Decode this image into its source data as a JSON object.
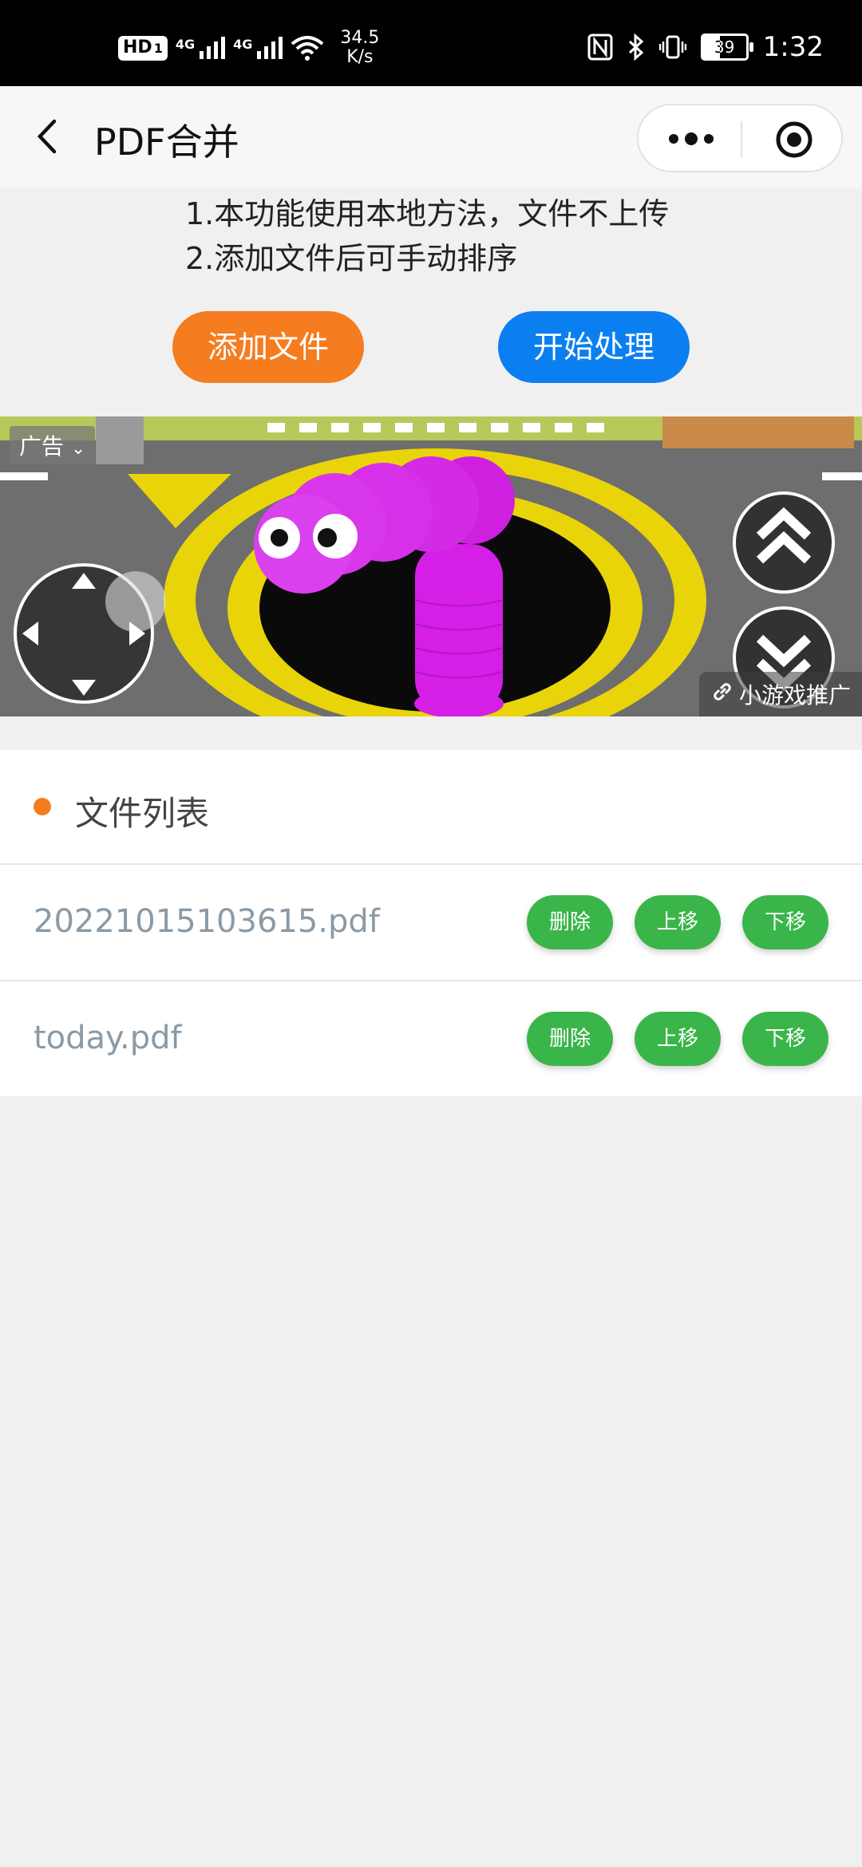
{
  "status_bar": {
    "hd_label": "HD",
    "sim": "1",
    "network_type_1": "4G",
    "network_type_2": "4G",
    "net_speed_value": "34.5",
    "net_speed_unit": "K/s",
    "battery_level": "39",
    "time": "1:32",
    "icons": [
      "hd-icon",
      "signal-icon",
      "signal-icon",
      "wifi-icon",
      "nfc-icon",
      "bluetooth-icon",
      "vibrate-icon",
      "battery-icon"
    ]
  },
  "nav": {
    "title": "PDF合并",
    "back_icon": "chevron-left-icon",
    "more_icon": "more-dots-icon",
    "close_icon": "target-circle-icon"
  },
  "instructions": [
    "1.本功能使用本地方法，文件不上传",
    "2.添加文件后可手动排序"
  ],
  "actions": {
    "add_files": "添加文件",
    "start": "开始处理",
    "add_color": "#f57c1f",
    "start_color": "#0b7ff0"
  },
  "ad": {
    "tag": "广告",
    "promo": "小游戏推广"
  },
  "file_list": {
    "title": "文件列表",
    "files": [
      {
        "name": "20221015103615.pdf",
        "delete": "删除",
        "up": "上移",
        "down": "下移"
      },
      {
        "name": "today.pdf",
        "delete": "删除",
        "up": "上移",
        "down": "下移"
      }
    ],
    "button_color": "#3ab54a"
  }
}
